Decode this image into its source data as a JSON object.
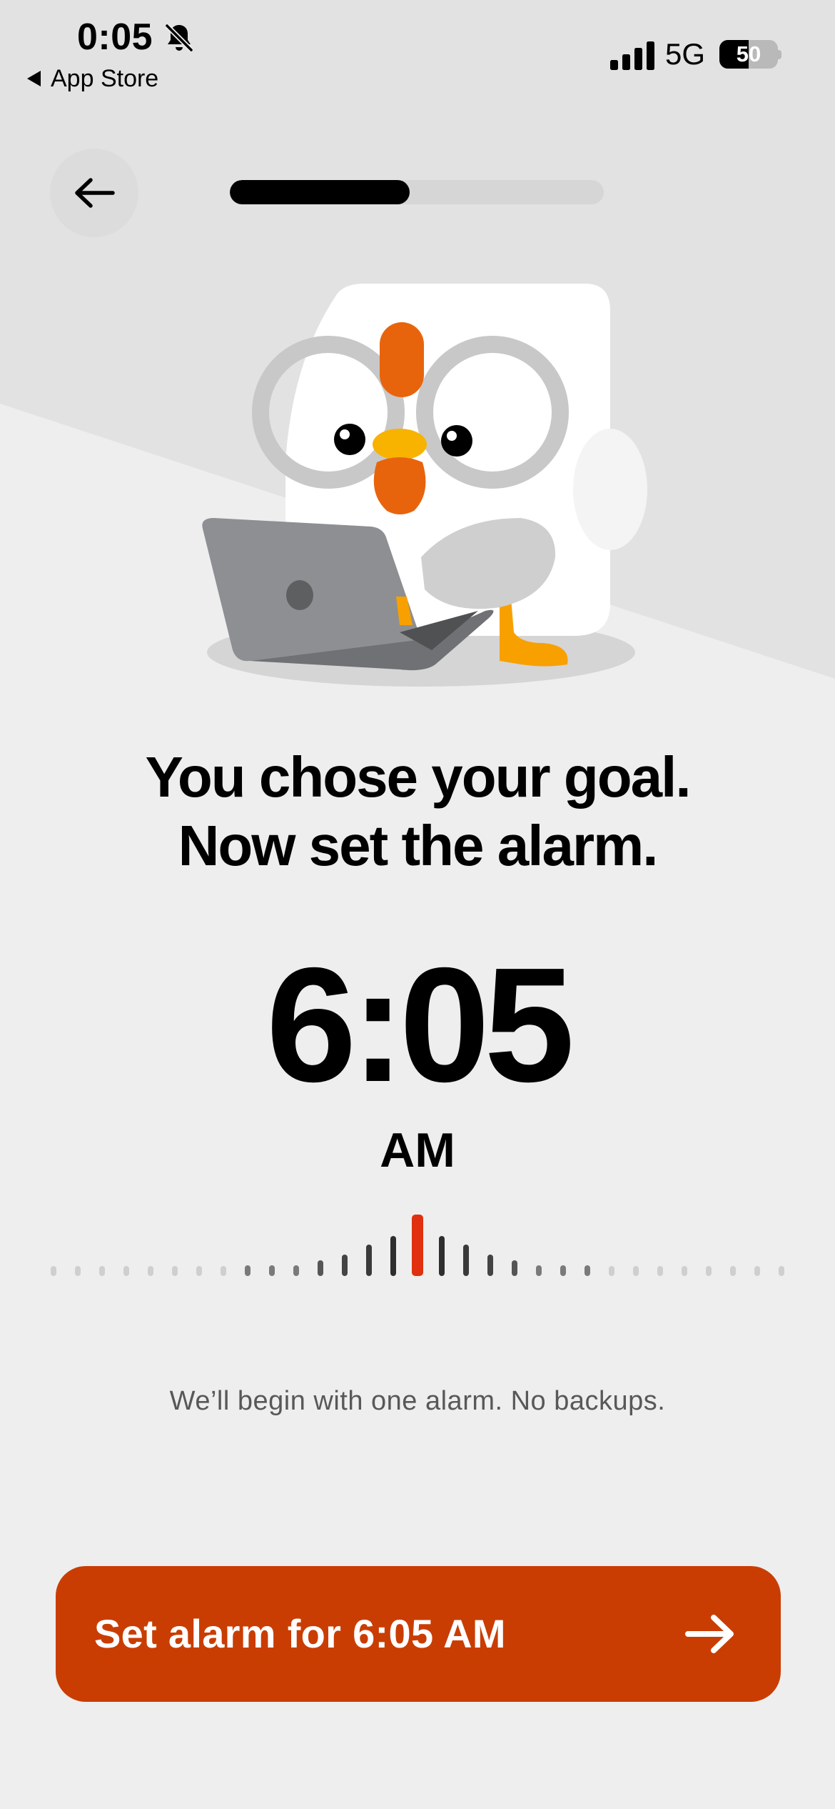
{
  "status_bar": {
    "time": "0:05",
    "back_app_label": "App Store",
    "network": "5G",
    "battery_percent": "50",
    "battery_level": 0.5,
    "icons": [
      "bell-slash-icon",
      "signal-bars-icon",
      "battery-icon"
    ]
  },
  "nav": {
    "back_icon": "arrow-left-icon",
    "progress_fraction": 0.48
  },
  "illustration": {
    "name": "mascot-chicken-with-laptop"
  },
  "content": {
    "headline_line1": "You chose your goal.",
    "headline_line2": "Now set the alarm.",
    "time": "6:05",
    "meridiem": "AM",
    "note": "We’ll begin with one alarm. No backups."
  },
  "cta": {
    "label": "Set alarm for 6:05 AM",
    "icon": "arrow-right-icon"
  },
  "colors": {
    "accent": "#c93d03",
    "picker_indicator": "#e0300f",
    "background": "#eeeeee",
    "background_top": "#e2e2e2"
  }
}
